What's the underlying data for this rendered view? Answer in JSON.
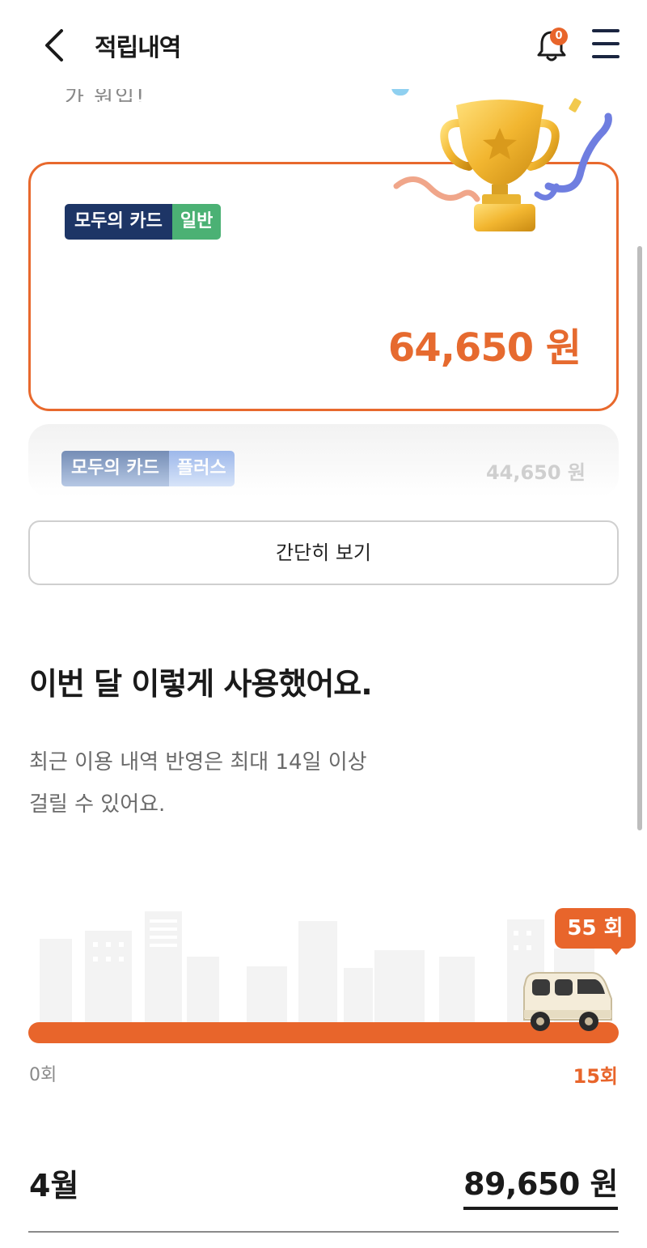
{
  "header": {
    "title": "적립내역",
    "notification_count": "0"
  },
  "partial_text": "가 원입!",
  "cards": {
    "primary": {
      "card_name": "모두의 카드",
      "card_tier": "일반",
      "amount": "64,650 원"
    },
    "secondary": {
      "card_name": "모두의 카드",
      "card_tier": "플러스",
      "amount": "44,650 원"
    }
  },
  "simple_view_button": "간단히 보기",
  "usage": {
    "title": "이번 달 이렇게 사용했어요.",
    "desc_line1": "최근 이용 내역 반영은 최대 14일 이상",
    "desc_line2": "걸릴 수 있어요.",
    "count_bubble": "55 회",
    "progress_fraction": 1.0,
    "min_label": "0회",
    "max_label": "15회"
  },
  "monthly": {
    "month": "4월",
    "amount": "89,650 원"
  },
  "colors": {
    "accent": "#e8652b",
    "navy": "#1d3566",
    "green": "#4bb174"
  },
  "icons": [
    "back-arrow-icon",
    "bell-icon",
    "hamburger-menu-icon",
    "trophy-icon",
    "van-icon",
    "city-skyline-icon"
  ]
}
